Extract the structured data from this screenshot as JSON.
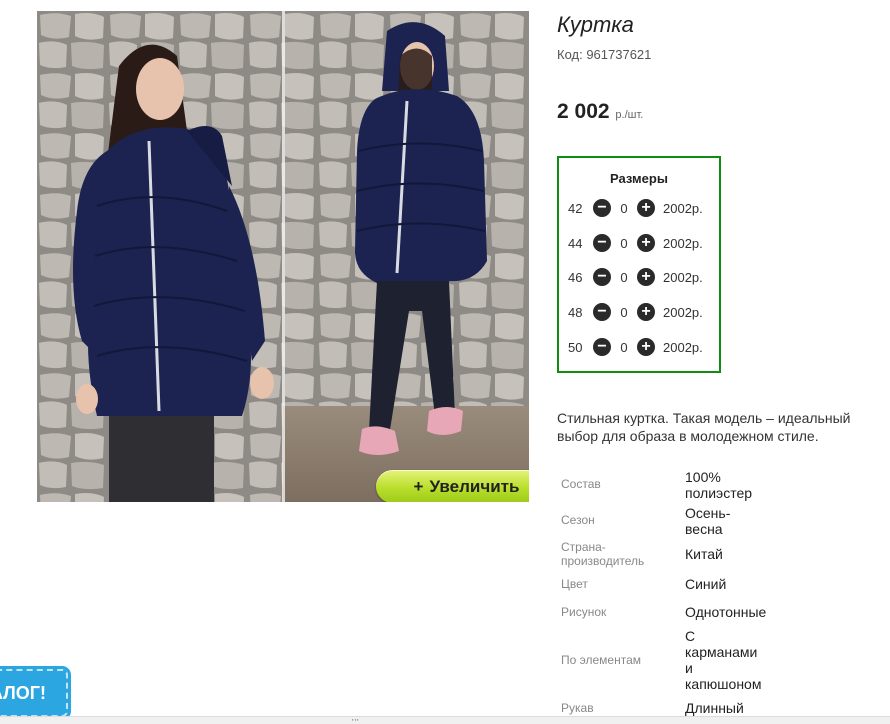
{
  "product": {
    "title": "Куртка",
    "code": "Код: 961737621",
    "price": "2 002",
    "price_unit": "р./шт."
  },
  "gallery": {
    "zoom_label": "Увеличить",
    "zoom_icon": "plus-icon"
  },
  "sizes": {
    "title": "Размеры",
    "rows": [
      {
        "size": "42",
        "qty": "0",
        "price": "2002р."
      },
      {
        "size": "44",
        "qty": "0",
        "price": "2002р."
      },
      {
        "size": "46",
        "qty": "0",
        "price": "2002р."
      },
      {
        "size": "48",
        "qty": "0",
        "price": "2002р."
      },
      {
        "size": "50",
        "qty": "0",
        "price": "2002р."
      }
    ],
    "minus_icon": "minus-circle-icon",
    "plus_icon": "plus-circle-icon",
    "border_color": "#108c10"
  },
  "description": "Стильная куртка. Такая модель – идеальный выбор для образа в молодежном стиле.",
  "specs": [
    {
      "label": "Состав",
      "value": "100% полиэстер"
    },
    {
      "label": "Сезон",
      "value": "Осень-весна"
    },
    {
      "label": "Страна-производитель",
      "value": "Китай"
    },
    {
      "label": "Цвет",
      "value": "Синий"
    },
    {
      "label": "Рисунок",
      "value": "Однотонные"
    },
    {
      "label": "По элементам",
      "value": "С карманами и капюшоном"
    },
    {
      "label": "Рукав",
      "value": "Длинный"
    }
  ],
  "catalog_tab": {
    "label": "АЛОГ!",
    "color": "#2ba6e0"
  },
  "scrollbar": {
    "grip": "'''"
  },
  "colors": {
    "zoom_button": "#b9de2c",
    "jacket": "#1c2350"
  }
}
